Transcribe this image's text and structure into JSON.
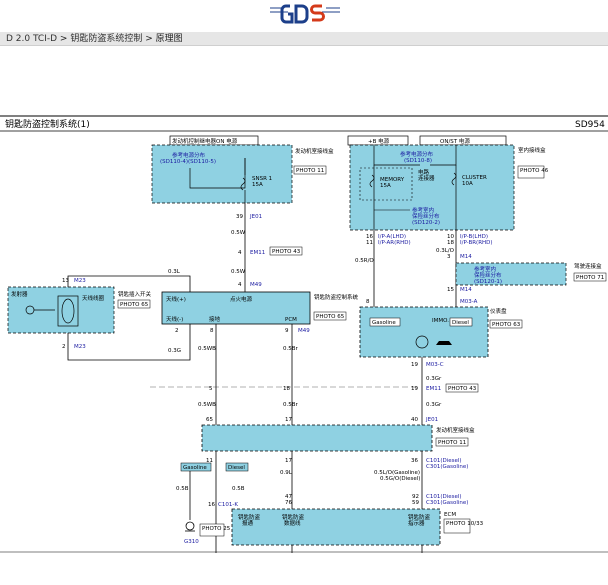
{
  "breadcrumb": {
    "part1": "D 2.0 TCI-D",
    "sep1": " > ",
    "part2": "钥匙防盗系统控制",
    "sep2": " > ",
    "part3": "原理图"
  },
  "header": {
    "title": "钥匙防盗控制系统(1)",
    "code": "SD954"
  },
  "fuse_left": {
    "title": "发动机控制继电器ON 电源",
    "sub1": "参考电源分布",
    "sub2": "(SD110-4)(SD110-5)",
    "fuse": "SNSR 1",
    "amp": "15A",
    "jb": "发动机室接线盒",
    "photo": "PHOTO 11"
  },
  "fuse_right": {
    "title_a": "+B 电源",
    "title_b": "ON/ST 电源",
    "sub1a": "参考电源分布",
    "sub1b": "(SD110-8)",
    "mem": "MEMORY",
    "mem_amp": "15A",
    "link1": "电路",
    "link2": "连接器",
    "sub2a": "参考室内",
    "sub2b": "保险丝分布",
    "sub2c": "(SD120-2)",
    "cluster": "CLUSTER",
    "cl_amp": "10A",
    "jb": "室内接线盒",
    "photo": "PHOTO 46"
  },
  "left_wires": {
    "pin39": "39",
    "jb01": "JE01",
    "w1": "0.5W",
    "pin4": "4",
    "em11": "EM11",
    "photo43": "PHOTO 43",
    "w2": "0.5W",
    "pin4b": "4",
    "m49": "M49"
  },
  "coil": {
    "pin13": "13",
    "m23a": "M23",
    "pin2": "2",
    "m23b": "M23",
    "label": "天线线圈",
    "title": "钥匙插入开关",
    "photo": "PHOTO 65",
    "w3": "0.3L",
    "w4": "0.3G",
    "ant": "发射器"
  },
  "immo_module": {
    "title": "钥匙防盗控制系统",
    "ant_pos": "天线(+)",
    "power": "点火电源",
    "ant_neg": "天线(-)",
    "gnd": "接地",
    "pcm": "PCM",
    "photo": "PHOTO 65",
    "pin2": "2",
    "pin8": "8",
    "pin9": "9",
    "m49": "M49"
  },
  "center_wires": {
    "w5": "0.5WB",
    "w6": "0.5Br",
    "pin5": "5",
    "pin18": "18",
    "w7": "0.5WB",
    "w8": "0.5Br",
    "pin65": "65",
    "pin17": "17"
  },
  "right_wires": {
    "p16": "16",
    "p11": "11",
    "ip_a": "I/P-A(LHD)",
    "ip_ar": "I/P-AR(RHD)",
    "p10": "10",
    "p18": "18",
    "ip_b": "I/P-B(LHD)",
    "ip_br": "I/P-BR(RHD)",
    "w9": "0.5R/O",
    "w10": "0.3L/O",
    "p3": "3",
    "m14": "M14",
    "p8": "8",
    "m14b": "M14",
    "p15": "15",
    "m03a": "M03-A",
    "fuse3_a": "参考室内",
    "fuse3_b": "保险丝分布",
    "fuse3_c": "(SD120-1)",
    "fuse3_jb": "驾驶连接盒",
    "fuse3_photo": "PHOTO 71"
  },
  "cluster_box": {
    "title": "仪表盘",
    "gasoline": "Gasoline",
    "immo": "IMMO.",
    "diesel": "Diesel",
    "photo": "PHOTO 63",
    "p19": "19",
    "m03c": "M03-C",
    "w11": "0.3Gr"
  },
  "bottom_wires": {
    "p19": "19",
    "em11": "EM11",
    "photo43": "PHOTO 43",
    "w12": "0.3Gr",
    "p40": "40",
    "je01": "JE01",
    "jb": "发动机室接线盒",
    "photo11": "PHOTO 11",
    "p11": "11",
    "p17": "17",
    "p36": "36",
    "c101": "C101(Diesel)",
    "c301": "C301(Gasoline)",
    "w13": "0.9L",
    "w14": "0.5L/O(Gasoline)",
    "w14b": "0.5G/O(Diesel)",
    "gasoline": "Gasoline",
    "diesel": "Diesel",
    "w15": "0.5B",
    "w16": "0.5B",
    "p16": "16",
    "c101k": "C101-K",
    "p47": "47",
    "p76": "76",
    "p92": "92",
    "p59": "59",
    "c101d": "C101(Diesel)",
    "c301g": "C301(Gasoline)",
    "ecm": "ECM",
    "ecm_photo": "PHOTO 10/33",
    "photo25": "PHOTO 25",
    "g310": "G310"
  },
  "ecm_box": {
    "l1": "钥匙防盗",
    "l1b": "报通",
    "l2": "钥匙防盗",
    "l2b": "数据线",
    "l3": "钥匙防盗",
    "l3b": "指示器"
  }
}
